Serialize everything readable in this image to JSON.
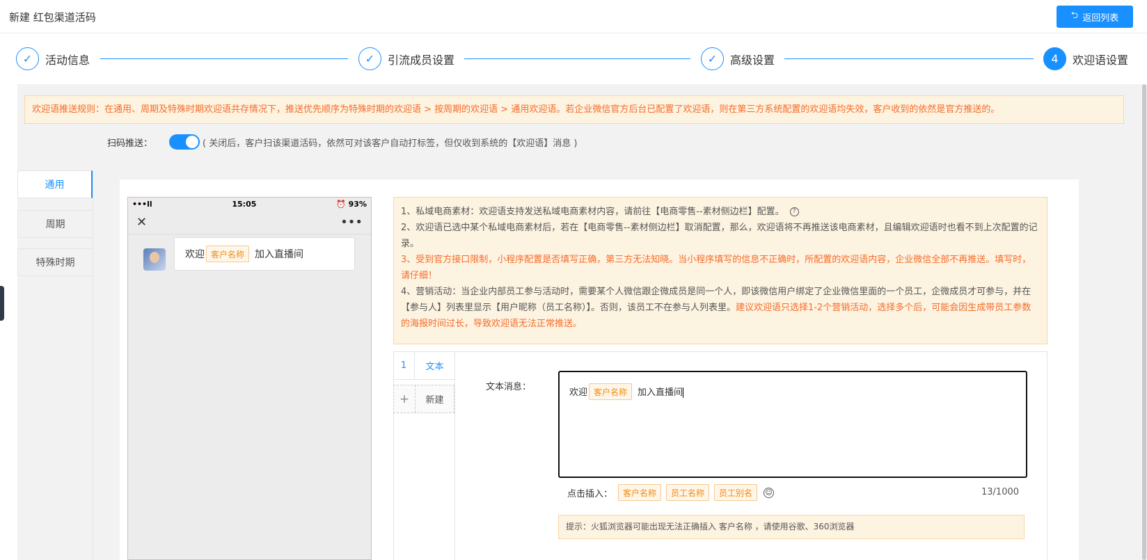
{
  "header": {
    "title": "新建 红包渠道活码",
    "back_label": "返回列表"
  },
  "steps": [
    {
      "mark": "✓",
      "label": "活动信息"
    },
    {
      "mark": "✓",
      "label": "引流成员设置"
    },
    {
      "mark": "✓",
      "label": "高级设置"
    },
    {
      "mark": "4",
      "label": "欢迎语设置"
    }
  ],
  "rule_text": "欢迎语推送规则：在通用、周期及特殊时期欢迎语共存情况下，推送优先顺序为特殊时期的欢迎语 > 按周期的欢迎语 > 通用欢迎语。若企业微信官方后台已配置了欢迎语，则在第三方系统配置的欢迎语均失效，客户收到的依然是官方推送的。",
  "scan_push": {
    "label": "扫码推送：",
    "enabled": true,
    "tip": "( 关闭后，客户扫该渠道活码，依然可对该客户自动打标签，但仅收到系统的【欢迎语】消息 )"
  },
  "side_tabs": [
    "通用",
    "周期",
    "特殊时期"
  ],
  "phone": {
    "signal": "•••ll",
    "time": "15:05",
    "battery": "⏰ 93%",
    "close": "✕",
    "more": "•••",
    "msg_prefix": "欢迎",
    "msg_tag": "客户名称",
    "msg_suffix": "加入直播间"
  },
  "notes": {
    "n1": "1、私域电商素材：欢迎语支持发送私域电商素材内容，请前往【电商零售--素材侧边栏】配置。",
    "n2": "2、欢迎语已选中某个私域电商素材后，若在【电商零售--素材侧边栏】取消配置，那么，欢迎语将不再推送该电商素材，且编辑欢迎语时也看不到上次配置的记录。",
    "n3": "3、受到官方接口限制，小程序配置是否填写正确，第三方无法知晓。当小程序填写的信息不正确时，所配置的欢迎语内容，企业微信全部不再推送。填写时，请仔细！",
    "n4a": "4、营销活动：当企业内部员工参与活动时，需要某个人微信跟企微成员是同一个人，即该微信用户绑定了企业微信里面的一个员工，企微成员才可参与，并在【参与人】列表里显示【用户昵称（员工名称）】。否则，该员工不在参与人列表里。",
    "n4b": "建议欢迎语只选择1-2个营销活动，选择多个后，可能会因生成带员工参数的海报时间过长，导致欢迎语无法正常推送。"
  },
  "message_tabs": [
    {
      "num": "1",
      "label": "文本"
    },
    {
      "num": "+",
      "label": "新建"
    }
  ],
  "editor": {
    "field_label": "文本消息：",
    "content_prefix": "欢迎",
    "content_tag": "客户名称",
    "content_suffix": "加入直播间",
    "insert_label": "点击插入：",
    "insert_tags": [
      "客户名称",
      "员工名称",
      "员工别名"
    ],
    "counter": "13/1000",
    "hint": "提示：火狐浏览器可能出现无法正确插入 客户名称 ，请使用谷歌、360浏览器"
  },
  "colors": {
    "accent": "#1890ff",
    "warn_bg": "#fdf3e1",
    "warn_text": "#f56c2a",
    "tag_text": "#f18b12"
  }
}
